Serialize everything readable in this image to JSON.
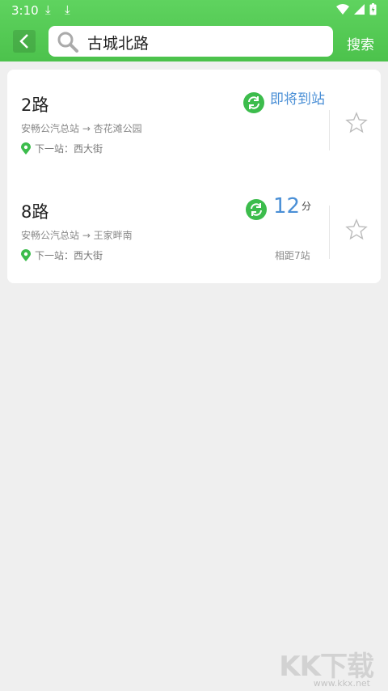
{
  "status": {
    "time": "3:10"
  },
  "search": {
    "query": "古城北路",
    "button_label": "搜索"
  },
  "routes": [
    {
      "name": "2路",
      "direction": "安畅公汽总站 → 杏花滩公园",
      "next_stop": "下一站：西大街",
      "arrival_text": "即将到站"
    },
    {
      "name": "8路",
      "direction": "安畅公汽总站 → 王家畔南",
      "next_stop": "下一站：西大街",
      "eta_value": "12",
      "eta_unit": "分",
      "distance": "相距7站"
    }
  ],
  "watermark": {
    "brand": "KK下载",
    "url": "www.kkx.net"
  },
  "colors": {
    "header": "#4cc24c",
    "accent_blue": "#4a8fd6",
    "green": "#3cbc4c"
  }
}
